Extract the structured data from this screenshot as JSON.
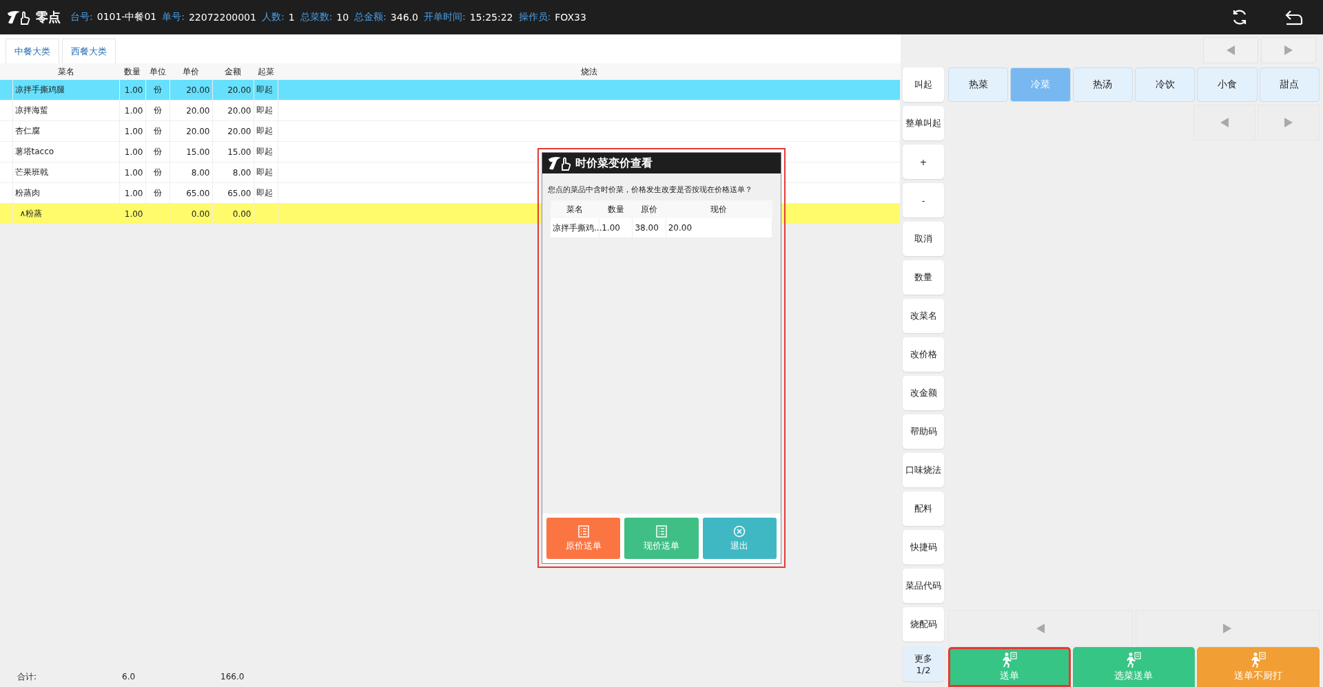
{
  "app": {
    "name": "零点"
  },
  "order_info": [
    {
      "label": "台号:",
      "value": "0101-中餐01"
    },
    {
      "label": "单号:",
      "value": "22072200001"
    },
    {
      "label": "人数:",
      "value": "1"
    },
    {
      "label": "总菜数:",
      "value": "10"
    },
    {
      "label": "总金额:",
      "value": "346.0"
    },
    {
      "label": "开单时间:",
      "value": "15:25:22"
    },
    {
      "label": "操作员:",
      "value": "FOX33"
    }
  ],
  "category_groups": [
    {
      "label": "中餐大类"
    },
    {
      "label": "西餐大类"
    }
  ],
  "table": {
    "columns": [
      "菜名",
      "数量",
      "单位",
      "单价",
      "金额",
      "起菜",
      "烧法"
    ],
    "rows": [
      {
        "kind": "dish",
        "selected": true,
        "name": "凉拌手撕鸡腿",
        "qty": "1.00",
        "unit": "份",
        "price": "20.00",
        "amount": "20.00",
        "serve": "即起"
      },
      {
        "kind": "dish",
        "selected": false,
        "name": "凉拌海蜇",
        "qty": "1.00",
        "unit": "份",
        "price": "20.00",
        "amount": "20.00",
        "serve": "即起"
      },
      {
        "kind": "dish",
        "selected": false,
        "name": "杏仁腐",
        "qty": "1.00",
        "unit": "份",
        "price": "20.00",
        "amount": "20.00",
        "serve": "即起"
      },
      {
        "kind": "dish",
        "selected": false,
        "name": "薯塔tacco",
        "qty": "1.00",
        "unit": "份",
        "price": "15.00",
        "amount": "15.00",
        "serve": "即起"
      },
      {
        "kind": "dish",
        "selected": false,
        "name": "芒果班戟",
        "qty": "1.00",
        "unit": "份",
        "price": "8.00",
        "amount": "8.00",
        "serve": "即起"
      },
      {
        "kind": "dish",
        "selected": false,
        "name": "粉蒸肉",
        "qty": "1.00",
        "unit": "份",
        "price": "65.00",
        "amount": "65.00",
        "serve": "即起"
      },
      {
        "kind": "addon",
        "selected": false,
        "name": "∧粉蒸",
        "qty": "1.00",
        "price": "0.00",
        "amount": "0.00"
      }
    ]
  },
  "totals": {
    "label": "合计:",
    "qty": "6.0",
    "amount": "166.0"
  },
  "side_actions": [
    {
      "label": "叫起"
    },
    {
      "label": "整单叫起"
    },
    {
      "label": "+"
    },
    {
      "label": "-"
    },
    {
      "label": "取消"
    },
    {
      "label": "数量"
    },
    {
      "label": "改菜名"
    },
    {
      "label": "改价格"
    },
    {
      "label": "改金额"
    },
    {
      "label": "帮助码"
    },
    {
      "label": "口味烧法"
    },
    {
      "label": "配料"
    },
    {
      "label": "快捷码"
    },
    {
      "label": "菜品代码"
    },
    {
      "label": "烧配码"
    },
    {
      "label": "更多",
      "page": "1/2"
    }
  ],
  "categories": [
    {
      "label": "热菜",
      "selected": false
    },
    {
      "label": "冷菜",
      "selected": true
    },
    {
      "label": "热汤",
      "selected": false
    },
    {
      "label": "冷饮",
      "selected": false
    },
    {
      "label": "小食",
      "selected": false
    },
    {
      "label": "甜点",
      "selected": false
    }
  ],
  "send_actions": [
    {
      "label": "送单",
      "color": "#36c585",
      "highlighted": true
    },
    {
      "label": "选菜送单",
      "color": "#36c585",
      "highlighted": false
    },
    {
      "label": "送单不厨打",
      "color": "#f19e34",
      "highlighted": false
    }
  ],
  "dialog": {
    "title": "时价菜变价查看",
    "highlighted": true,
    "message": "您点的菜品中含时价菜，价格发生改变是否按现在价格送单？",
    "columns": [
      "菜名",
      "数量",
      "原价",
      "现价"
    ],
    "rows": [
      {
        "name": "凉拌手撕鸡...",
        "qty": "1.00",
        "old_price": "38.00",
        "new_price": "20.00"
      }
    ],
    "buttons": [
      {
        "label": "原价送单",
        "kind": "list",
        "color": "#fb7543"
      },
      {
        "label": "现价送单",
        "kind": "list",
        "color": "#3fbf86"
      },
      {
        "label": "退出",
        "kind": "close",
        "color": "#3fb8c4"
      }
    ]
  }
}
